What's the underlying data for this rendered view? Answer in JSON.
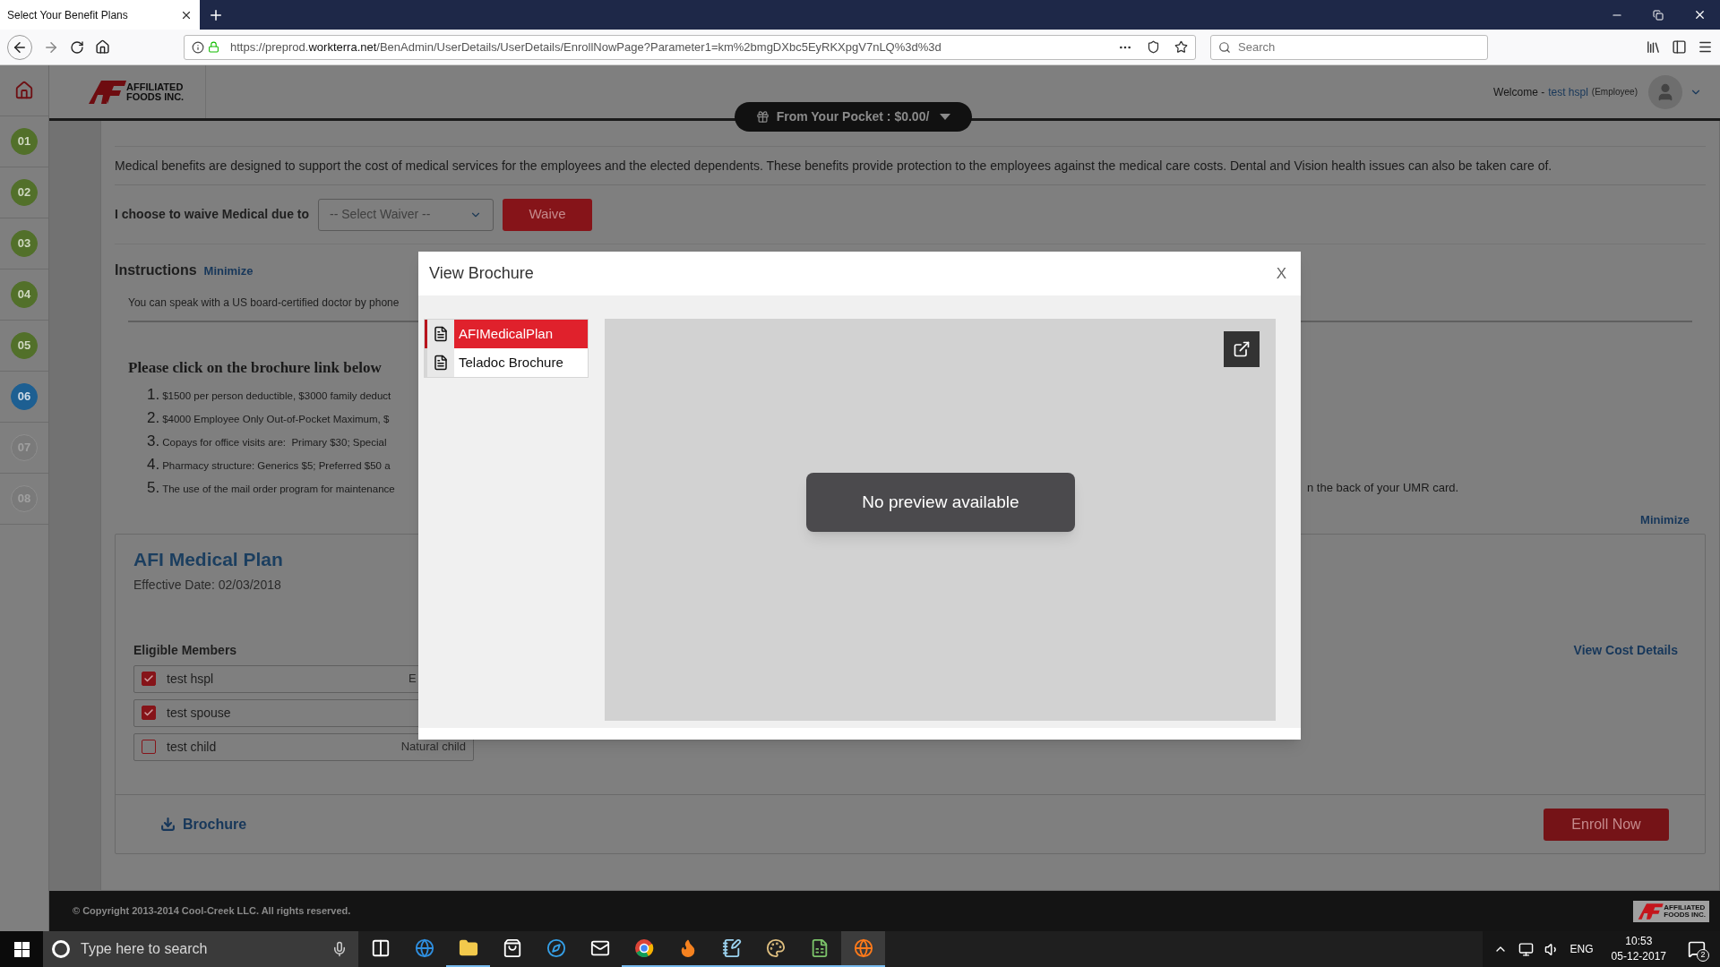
{
  "browser": {
    "tab_title": "Select Your Benefit Plans",
    "url_prefix": "https://preprod.",
    "url_domain": "workterra.net",
    "url_path": "/BenAdmin/UserDetails/UserDetails/EnrollNowPage?Parameter1=km%2bmgDXbc5EyRKXpgV7nLQ%3d%3d",
    "search_placeholder": "Search"
  },
  "header": {
    "logo_line1": "AFFILIATED",
    "logo_line2": "FOODS INC.",
    "welcome": "Welcome -",
    "user": "test hspl",
    "role": "(Employee)",
    "pocket": "From Your Pocket : $0.00/"
  },
  "steps": [
    {
      "label": "01",
      "done": true,
      "selected": false
    },
    {
      "label": "02",
      "done": true,
      "selected": false
    },
    {
      "label": "03",
      "done": true,
      "selected": false
    },
    {
      "label": "04",
      "done": true,
      "selected": false
    },
    {
      "label": "05",
      "done": true,
      "selected": false
    },
    {
      "label": "06",
      "done": false,
      "selected": true
    },
    {
      "label": "07",
      "done": false,
      "selected": false
    },
    {
      "label": "08",
      "done": false,
      "selected": false
    }
  ],
  "content": {
    "description": "Medical benefits are designed to support the cost of medical services for the employees and the elected dependents. These benefits provide protection to the employees against the medical care costs. Dental and Vision health issues can also be taken care of.",
    "waive_label": "I choose to waive Medical due to",
    "waiver_placeholder": "-- Select Waiver --",
    "waive_button": "Waive",
    "instructions_title": "Instructions",
    "minimize_link": "Minimize",
    "instructions_text": "You can speak with a US board-certified doctor by phone",
    "brochure_heading": "Please click on the brochure link below",
    "brochure_items": [
      {
        "number": "1.",
        "text": "$1500 per person deductible, $3000 family deduct"
      },
      {
        "number": "2.",
        "text": "$4000 Employee Only Out-of-Pocket Maximum, $"
      },
      {
        "number": "3.",
        "text": "Copays for office visits are:  Primary $30; Special"
      },
      {
        "number": "4.",
        "text": "Pharmacy structure: Generics $5; Preferred $50 a"
      },
      {
        "number": "5.",
        "text": "The use of the mail order program for maintenance",
        "text_after": "n the back of your UMR card."
      }
    ],
    "minimize_link_2": "Minimize"
  },
  "plan": {
    "title": "AFI Medical Plan",
    "effective_date": "Effective Date: 02/03/2018",
    "members_title": "Eligible Members",
    "members": [
      {
        "name": "test hspl",
        "relation": "E",
        "checked": true
      },
      {
        "name": "test spouse",
        "checked": true
      },
      {
        "name": "test child",
        "relation": "Natural child",
        "checked": false
      }
    ],
    "cost_link": "View Cost Details",
    "brochure_link": "Brochure",
    "enroll_button": "Enroll Now"
  },
  "modal": {
    "title": "View Brochure",
    "close": "X",
    "files": [
      {
        "name": "AFIMedicalPlan",
        "selected": true
      },
      {
        "name": "Teladoc Brochure",
        "selected": false
      }
    ],
    "preview_message": "No preview available"
  },
  "footer": {
    "copyright": "© Copyright 2013-2014 Cool-Creek LLC. All rights reserved.",
    "logo_line1": "AFFILIATED",
    "logo_line2": "FOODS INC."
  },
  "taskbar": {
    "search_placeholder": "Type here to search",
    "apps": [
      {
        "kind": "taskview",
        "running": false
      },
      {
        "kind": "edge",
        "running": false
      },
      {
        "kind": "folder",
        "running": true
      },
      {
        "kind": "store",
        "running": false
      },
      {
        "kind": "compass",
        "running": false
      },
      {
        "kind": "mail",
        "running": false
      },
      {
        "kind": "chrome",
        "running": true
      },
      {
        "kind": "flame",
        "running": true
      },
      {
        "kind": "notebook",
        "running": true
      },
      {
        "kind": "palette",
        "running": true
      },
      {
        "kind": "sheet",
        "running": true
      },
      {
        "kind": "firefox",
        "running": true
      }
    ],
    "language": "ENG",
    "time": "10:53",
    "date": "05-12-2017",
    "notifications": "2"
  }
}
